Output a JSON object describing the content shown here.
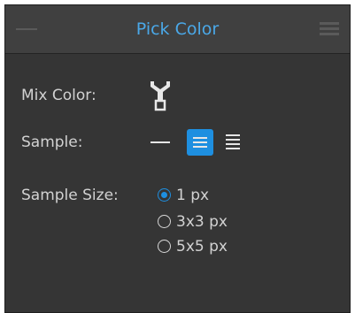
{
  "panel": {
    "title": "Pick Color",
    "accent_color": "#1e8fe0"
  },
  "mix_color": {
    "label": "Mix Color:",
    "icon": "color-picker-mixer-icon"
  },
  "sample": {
    "label": "Sample:",
    "options": [
      {
        "icon": "single-line-icon",
        "selected": false
      },
      {
        "icon": "three-lines-icon",
        "selected": true
      },
      {
        "icon": "five-lines-icon",
        "selected": false
      }
    ]
  },
  "sample_size": {
    "label": "Sample Size:",
    "options": [
      {
        "label": "1 px",
        "checked": true
      },
      {
        "label": "3x3 px",
        "checked": false
      },
      {
        "label": "5x5 px",
        "checked": false
      }
    ]
  }
}
